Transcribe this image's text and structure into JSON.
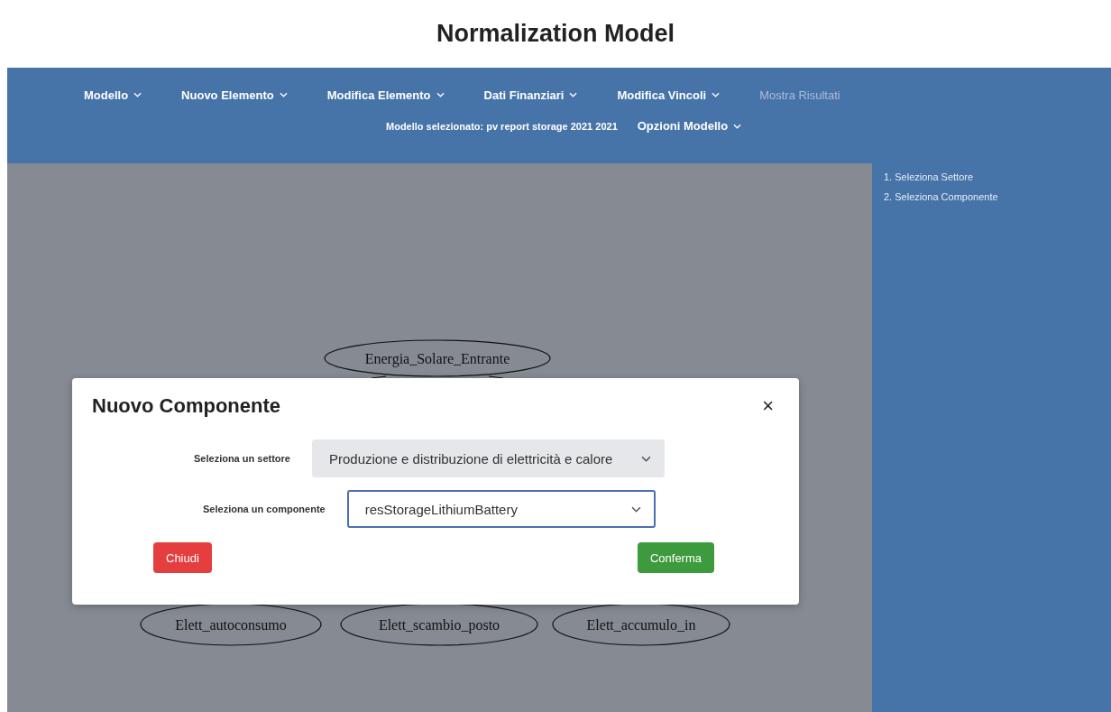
{
  "header": {
    "title": "Normalization Model"
  },
  "nav": {
    "items": [
      {
        "label": "Modello",
        "kind": "dropdown",
        "disabled": false
      },
      {
        "label": "Nuovo Elemento",
        "kind": "dropdown",
        "disabled": false
      },
      {
        "label": "Modifica Elemento",
        "kind": "dropdown",
        "disabled": false
      },
      {
        "label": "Dati Finanziari",
        "kind": "dropdown",
        "disabled": false
      },
      {
        "label": "Modifica Vincoli",
        "kind": "dropdown",
        "disabled": false
      },
      {
        "label": "Mostra Risultati",
        "kind": "link",
        "disabled": true
      }
    ],
    "model_info": "Modello selezionato: pv report storage 2021 2021",
    "model_options": {
      "label": "Opzioni Modello",
      "kind": "dropdown",
      "disabled": false
    }
  },
  "graph": {
    "nodes": [
      {
        "label": "Energia_Solare_Entrante"
      },
      {
        "label": "Elett_autoconsumo"
      },
      {
        "label": "Elett_scambio_posto"
      },
      {
        "label": "Elett_accumulo_in"
      }
    ]
  },
  "sidebar": {
    "steps": [
      "1. Seleziona Settore",
      "2. Seleziona Componente"
    ]
  },
  "modal": {
    "title": "Nuovo Componente",
    "close": "×",
    "fields": [
      {
        "label": "Seleziona un settore",
        "value": "Produzione e distribuzione di elettricità e calore",
        "disabled": true,
        "focused": false
      },
      {
        "label": "Seleziona un componente",
        "value": "resStorageLithiumBattery",
        "disabled": false,
        "focused": true
      }
    ],
    "buttons": [
      {
        "label": "Chiudi",
        "kind": "danger"
      },
      {
        "label": "Conferma",
        "kind": "success"
      }
    ]
  }
}
